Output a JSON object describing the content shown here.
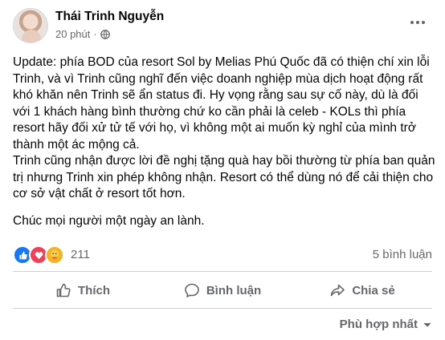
{
  "post": {
    "author": "Thái Trinh Nguyễn",
    "time": "20 phút",
    "separator": "·",
    "paragraphs": [
      "Update: phía BOD của resort Sol by Melias Phú Quốc đã có thiện chí xin lỗi Trinh, và vì Trinh cũng nghĩ đến việc doanh nghiệp mùa dịch hoạt động rất khó khăn nên Trinh sẽ ẩn status đi. Hy vọng rằng sau sự cố này, dù là đối với 1 khách hàng bình thường chứ ko cần phải là celeb - KOLs thì phía resort hãy đối xử tử tế với họ, vì không một ai muốn kỳ nghỉ của mình trở thành một ác mộng cả.\nTrinh cũng nhận được lời đề nghị tặng quà hay bồi thường từ phía ban quản trị nhưng Trinh xin phép không nhận. Resort có thể dùng nó để cải thiện cho cơ sở vật chất ở resort tốt hơn.",
      "Chúc mọi người một ngày an lành."
    ]
  },
  "reactions": {
    "icons": [
      "like-icon",
      "love-icon",
      "care-icon"
    ],
    "count": "211",
    "comments": "5 bình luận"
  },
  "actions": {
    "like": "Thích",
    "comment": "Bình luận",
    "share": "Chia sẻ"
  },
  "sort": {
    "label": "Phù hợp nhất"
  },
  "colors": {
    "accent": "#1877f2",
    "love": "#f33e58",
    "care": "#f7b125",
    "secondary_text": "#65676b"
  }
}
